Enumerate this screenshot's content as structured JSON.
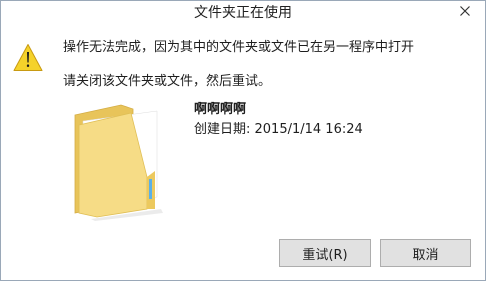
{
  "dialog": {
    "title": "文件夹正在使用",
    "message_line1": "操作无法完成，因为其中的文件夹或文件已在另一程序中打开",
    "message_line2": "请关闭该文件夹或文件，然后重试。",
    "item": {
      "name": "啊啊啊啊",
      "created_label": "创建日期: 2015/1/14 16:24"
    },
    "buttons": {
      "retry": "重试(R)",
      "cancel": "取消"
    }
  },
  "icons": {
    "close": "close-icon",
    "warning": "warning-icon",
    "folder": "folder-icon"
  },
  "colors": {
    "window_border": "#9aa8b8",
    "button_face": "#e1e1e1",
    "button_border": "#adadad",
    "warning_yellow": "#f5d22a",
    "folder_yellow": "#f4d87a"
  }
}
